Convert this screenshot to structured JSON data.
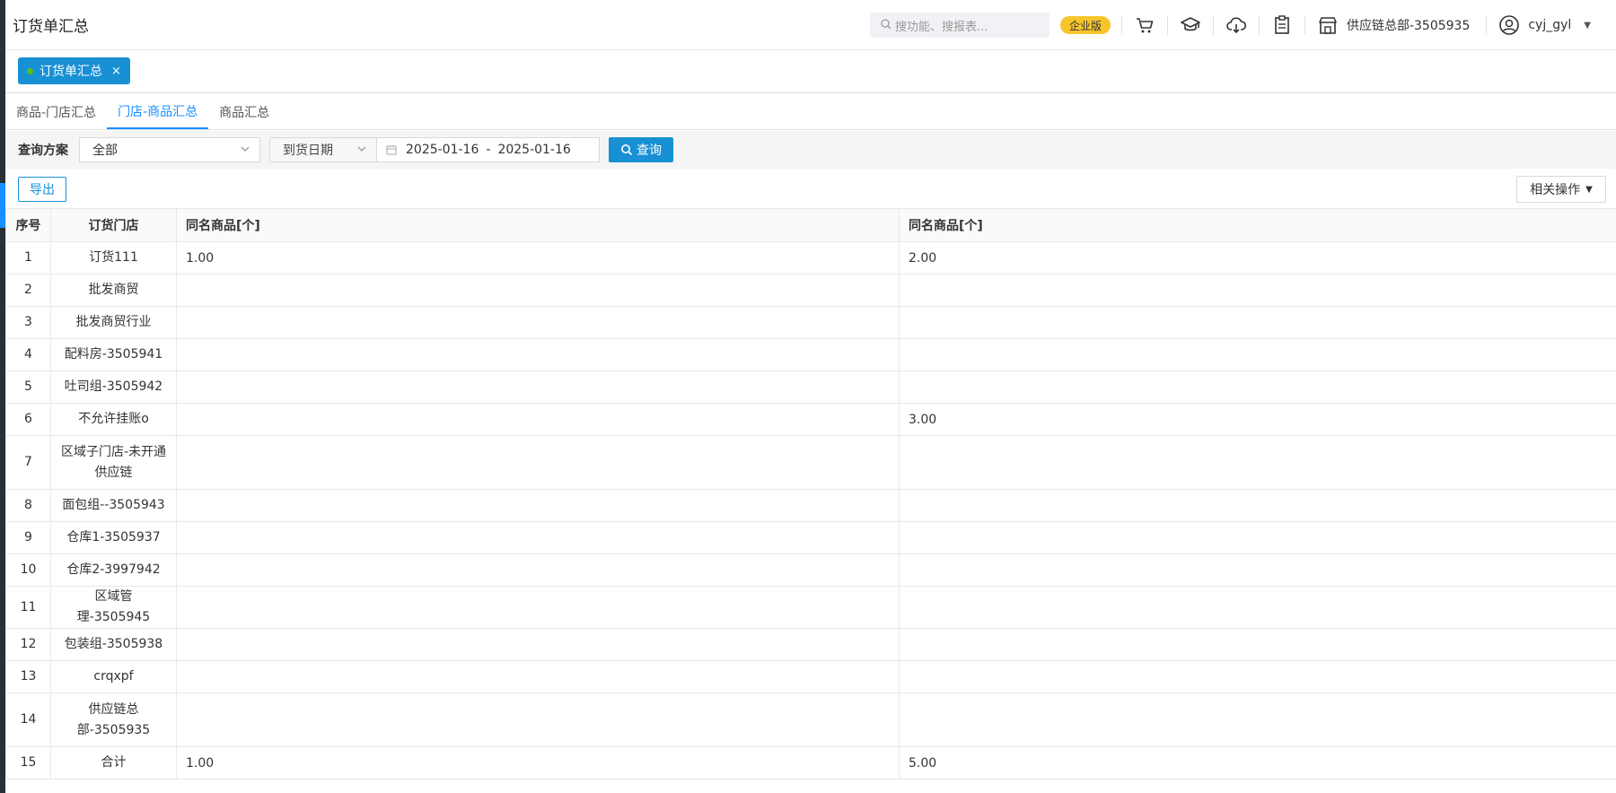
{
  "header": {
    "title": "订货单汇总",
    "search_placeholder": "搜功能、搜报表...",
    "edition_badge": "企业版",
    "org_name": "供应链总部-3505935",
    "username": "cyj_gyl",
    "icons": [
      "cart-icon",
      "graduation-cap-icon",
      "cloud-download-icon",
      "clipboard-icon",
      "store-icon",
      "user-circle-icon"
    ]
  },
  "open_tab": {
    "label": "订货单汇总",
    "close": "×"
  },
  "sub_tabs": [
    {
      "label": "商品-门店汇总",
      "active": false
    },
    {
      "label": "门店-商品汇总",
      "active": true
    },
    {
      "label": "商品汇总",
      "active": false
    }
  ],
  "filter": {
    "scheme_label": "查询方案",
    "scheme_value": "全部",
    "date_type": "到货日期",
    "date_start": "2025-01-16",
    "date_sep": "-",
    "date_end": "2025-01-16",
    "query_label": "查询"
  },
  "actions": {
    "export_label": "导出",
    "related_label": "相关操作"
  },
  "table": {
    "headers": [
      "序号",
      "订货门店",
      "同名商品[个]",
      "同名商品[个]"
    ],
    "rows": [
      {
        "seq": "1",
        "store": "订货111",
        "a": "1.00",
        "b": "2.00"
      },
      {
        "seq": "2",
        "store": "批发商贸",
        "a": "",
        "b": ""
      },
      {
        "seq": "3",
        "store": "批发商贸行业",
        "a": "",
        "b": ""
      },
      {
        "seq": "4",
        "store": "配料房-3505941",
        "a": "",
        "b": ""
      },
      {
        "seq": "5",
        "store": "吐司组-3505942",
        "a": "",
        "b": ""
      },
      {
        "seq": "6",
        "store": "不允许挂账o",
        "a": "",
        "b": "3.00"
      },
      {
        "seq": "7",
        "store": "区域子门店-未开通供应链",
        "a": "",
        "b": ""
      },
      {
        "seq": "8",
        "store": "面包组--3505943",
        "a": "",
        "b": ""
      },
      {
        "seq": "9",
        "store": "仓库1-3505937",
        "a": "",
        "b": ""
      },
      {
        "seq": "10",
        "store": "仓库2-3997942",
        "a": "",
        "b": ""
      },
      {
        "seq": "11",
        "store": "区域管理-3505945",
        "a": "",
        "b": ""
      },
      {
        "seq": "12",
        "store": "包装组-3505938",
        "a": "",
        "b": ""
      },
      {
        "seq": "13",
        "store": "crqxpf",
        "a": "",
        "b": ""
      },
      {
        "seq": "14",
        "store": "供应链总部-3505935",
        "a": "",
        "b": ""
      },
      {
        "seq": "15",
        "store": "合计",
        "a": "1.00",
        "b": "5.00"
      }
    ]
  },
  "colors": {
    "primary": "#1890d4",
    "badge": "#f7c52b",
    "tab_dot": "#52c41a"
  }
}
